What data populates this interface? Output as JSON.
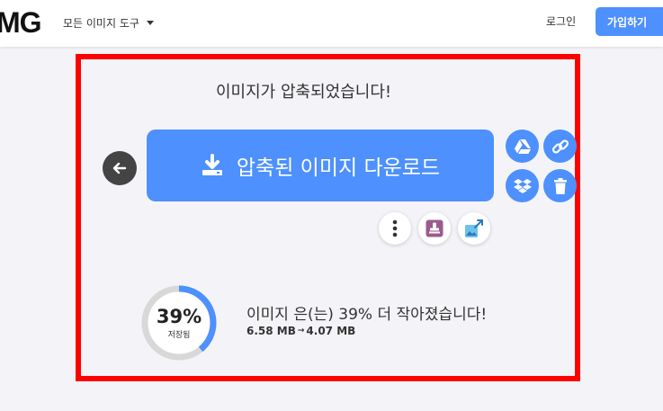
{
  "header": {
    "logo": "MG",
    "tools_menu": "모든 이미지 도구",
    "login": "로그인",
    "signup": "가입하기"
  },
  "panel": {
    "title": "이미지가 압축되었습니다!",
    "download_label": "압축된 이미지 다운로드"
  },
  "result": {
    "percent": "39%",
    "percent_value": 0.39,
    "saved_label": "저장됨",
    "message": "이미지 은(는) 39% 더 작아졌습니다!",
    "size_before": "6.58 MB",
    "size_after": "4.07 MB"
  },
  "colors": {
    "accent": "#4d90fe",
    "highlight": "#ff0000",
    "back": "#444444",
    "gauge_track": "#d8d8d8"
  }
}
